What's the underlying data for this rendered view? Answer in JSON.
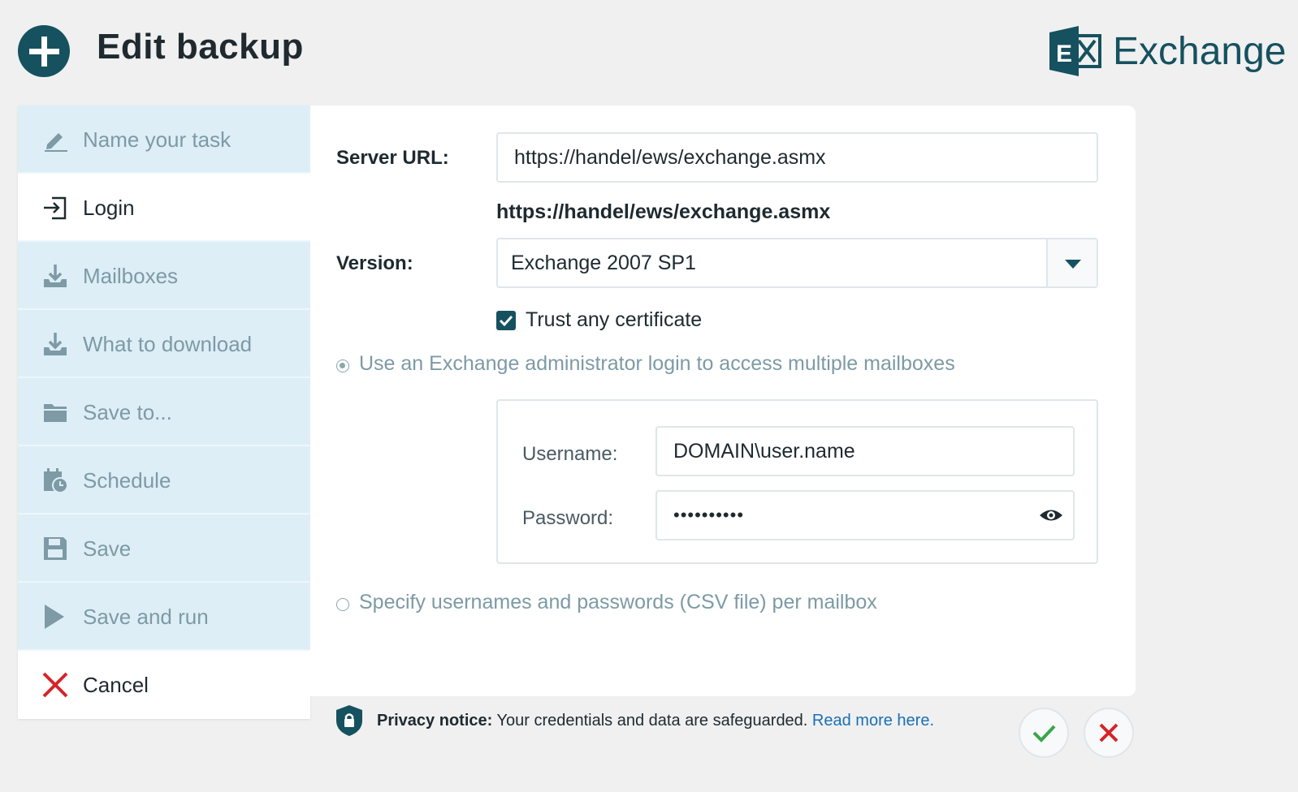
{
  "header": {
    "title": "Edit backup",
    "logo_text": "Exchange",
    "logo_mark_letter": "E",
    "accent_color": "#16515f"
  },
  "sidebar": {
    "items": [
      {
        "label": "Name your task",
        "icon": "pencil-icon",
        "state": "inactive"
      },
      {
        "label": "Login",
        "icon": "login-icon",
        "state": "active"
      },
      {
        "label": "Mailboxes",
        "icon": "download-icon",
        "state": "inactive"
      },
      {
        "label": "What to download",
        "icon": "download-icon",
        "state": "inactive"
      },
      {
        "label": "Save to...",
        "icon": "folder-icon",
        "state": "inactive"
      },
      {
        "label": "Schedule",
        "icon": "calendar-clock-icon",
        "state": "inactive"
      },
      {
        "label": "Save",
        "icon": "floppy-icon",
        "state": "inactive"
      },
      {
        "label": "Save and run",
        "icon": "play-icon",
        "state": "inactive"
      },
      {
        "label": "Cancel",
        "icon": "close-icon",
        "state": "cancel"
      }
    ]
  },
  "form": {
    "server_url_label": "Server URL:",
    "server_url_value": "https://handel/ews/exchange.asmx",
    "server_url_echo": "https://handel/ews/exchange.asmx",
    "version_label": "Version:",
    "version_value": "Exchange 2007 SP1",
    "trust_label": "Trust any certificate",
    "trust_checked": true,
    "admin_option_label": "Use an Exchange administrator login to access multiple mailboxes",
    "username_label": "Username:",
    "username_value": "DOMAIN\\user.name",
    "password_label": "Password:",
    "password_value": "••••••••••",
    "csv_option_label": "Specify usernames and passwords (CSV file) per mailbox"
  },
  "footer": {
    "privacy_title": "Privacy notice:",
    "privacy_text": " Your credentials and data are safeguarded. ",
    "privacy_link": "Read more here.",
    "confirm_icon": "check-icon",
    "cancel_icon": "close-icon"
  }
}
